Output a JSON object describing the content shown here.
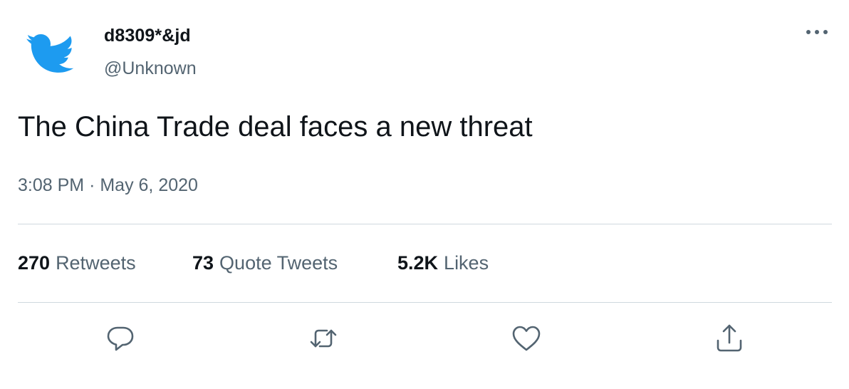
{
  "user": {
    "display_name": "d8309*&jd",
    "handle": "@Unknown",
    "avatar_icon": "twitter-bird-icon",
    "brand_color": "#1d9bf0"
  },
  "tweet": {
    "text": "The China Trade deal faces a new threat",
    "time": "3:08 PM",
    "separator": "·",
    "date": "May 6, 2020"
  },
  "stats": {
    "retweets_count": "270",
    "retweets_label": "Retweets",
    "quotes_count": "73",
    "quotes_label": "Quote Tweets",
    "likes_count": "5.2K",
    "likes_label": "Likes"
  },
  "actions": {
    "reply_icon": "reply-icon",
    "retweet_icon": "retweet-icon",
    "like_icon": "heart-icon",
    "share_icon": "share-icon",
    "more_icon": "more-dots-icon"
  },
  "colors": {
    "text_primary": "#0f1419",
    "text_secondary": "#536471",
    "divider": "#cfd9de"
  }
}
